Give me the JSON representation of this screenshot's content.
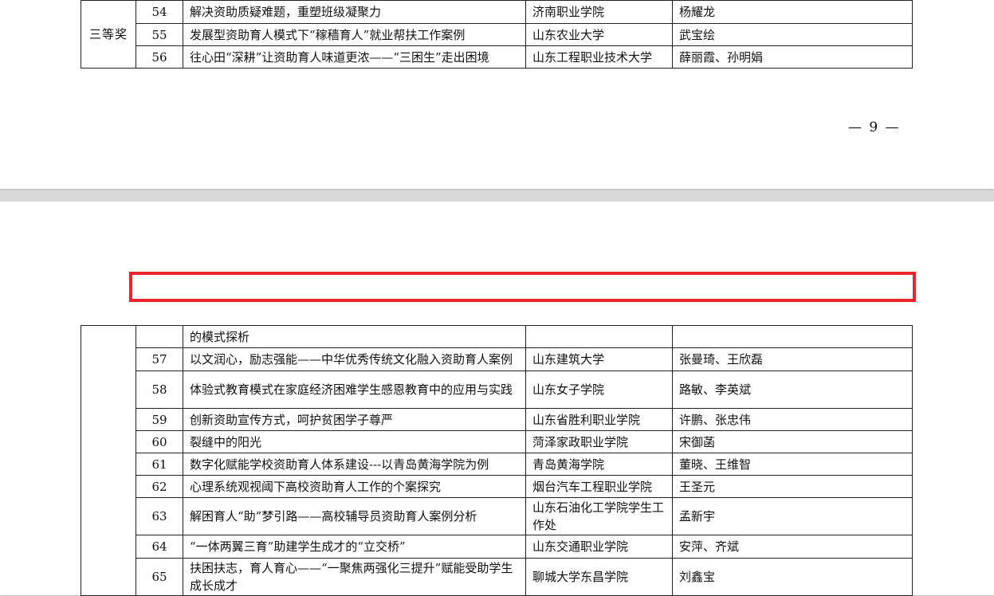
{
  "page1": {
    "grade_label": "三等奖",
    "rows": [
      {
        "no": "54",
        "title": "解决资助质疑难题，重塑班级凝聚力",
        "school": "济南职业学院",
        "authors": "杨耀龙"
      },
      {
        "no": "55",
        "title": "发展型资助育人模式下“稼穑育人”就业帮扶工作案例",
        "school": "山东农业大学",
        "authors": "武宝绘"
      },
      {
        "no": "56",
        "title": "往心田“深耕”让资助育人味道更浓——“三困生”走出困境",
        "school": "山东工程职业技术大学",
        "authors": "薛丽霞、孙明娟"
      }
    ],
    "page_number": "— 9 —"
  },
  "page2": {
    "rows": [
      {
        "no": "",
        "title": "的模式探析",
        "school": "",
        "authors": ""
      },
      {
        "no": "57",
        "title": "以文润心，励志强能——中华优秀传统文化融入资助育人案例",
        "school": "山东建筑大学",
        "authors": "张曼琦、王欣磊"
      },
      {
        "no": "58",
        "title": "体验式教育模式在家庭经济困难学生感恩教育中的应用与实践",
        "school": "山东女子学院",
        "authors": "路敏、李英斌"
      },
      {
        "no": "59",
        "title": "创新资助宣传方式，呵护贫困学子尊严",
        "school": "山东省胜利职业学院",
        "authors": "许鹏、张忠伟"
      },
      {
        "no": "60",
        "title": "裂缝中的阳光",
        "school": "菏泽家政职业学院",
        "authors": "宋御菡"
      },
      {
        "no": "61",
        "title": "数字化赋能学校资助育人体系建设---以青岛黄海学院为例",
        "school": "青岛黄海学院",
        "authors": "董晓、王维智"
      },
      {
        "no": "62",
        "title": "心理系统观视阈下高校资助育人工作的个案探究",
        "school": "烟台汽车工程职业学院",
        "authors": "王圣元"
      },
      {
        "no": "63",
        "title": "解困育人“助”梦引路——高校辅导员资助育人案例分析",
        "school": "山东石油化工学院学生工作处",
        "authors": "孟新宇"
      },
      {
        "no": "64",
        "title": "“一体两翼三育”助建学生成才的“立交桥”",
        "school": "山东交通职业学院",
        "authors": "安萍、齐斌"
      },
      {
        "no": "65",
        "title": "扶困扶志，育人育心——“一聚焦两强化三提升”赋能受助学生成长成才",
        "school": "聊城大学东昌学院",
        "authors": "刘鑫宝"
      }
    ]
  },
  "highlight_color": "#e8262b"
}
